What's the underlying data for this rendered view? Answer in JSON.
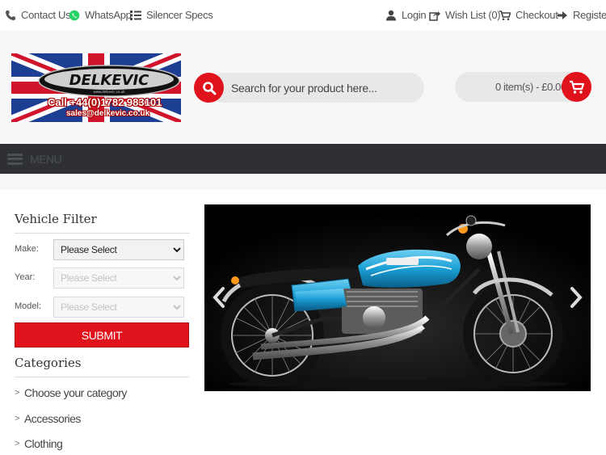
{
  "topbar": {
    "contact": "Contact Us",
    "whatsapp": "WhatsApp",
    "silencer": "Silencer Specs",
    "login": "Login",
    "wishlist": "Wish List (0)",
    "checkout": "Checkout",
    "register": "Register"
  },
  "logo": {
    "brand": "DELKEVIC",
    "tagline": "www.delkevic.co.uk",
    "phone": "Call +44(0)1782 983101",
    "email": "sales@delkevic.co.uk"
  },
  "search": {
    "placeholder": "Search for your product here..."
  },
  "cart": {
    "summary": "0 item(s) - £0.00"
  },
  "menu": {
    "label": "MENU"
  },
  "filter": {
    "title": "Vehicle Filter",
    "make_label": "Make:",
    "make_value": "Please Select",
    "year_label": "Year:",
    "year_value": "Please Select",
    "model_label": "Model:",
    "model_value": "Please Select",
    "submit": "SUBMIT"
  },
  "categories": {
    "title": "Categories",
    "items": [
      "Choose your category",
      "Accessories",
      "Clothing"
    ]
  },
  "colors": {
    "accent": "#e0121b",
    "menubar": "#2e3033",
    "bike_tank": "#1ba0d6"
  }
}
